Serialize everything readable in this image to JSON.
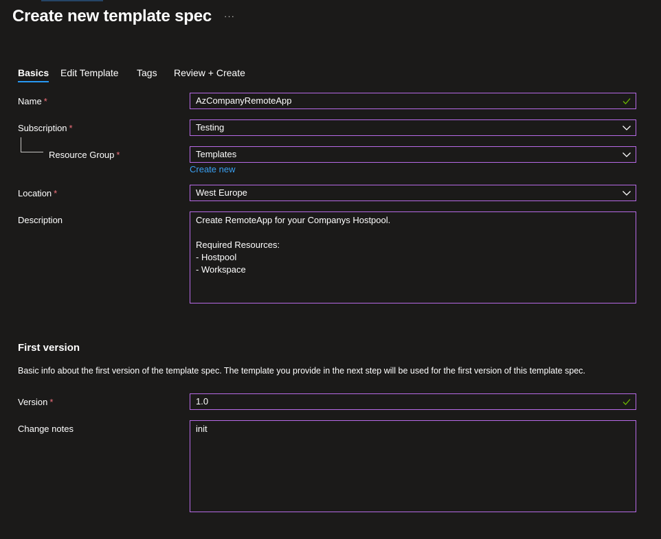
{
  "page": {
    "title": "Create new template spec",
    "more_label": "···"
  },
  "tabs": [
    {
      "label": "Basics",
      "active": true
    },
    {
      "label": "Edit Template",
      "active": false
    },
    {
      "label": "Tags",
      "active": false
    },
    {
      "label": "Review + Create",
      "active": false
    }
  ],
  "form": {
    "name": {
      "label": "Name",
      "required": "*",
      "value": "AzCompanyRemoteApp",
      "valid_icon": "checkmark-icon"
    },
    "subscription": {
      "label": "Subscription",
      "required": "*",
      "value": "Testing",
      "icon": "chevron-down-icon"
    },
    "resource_group": {
      "label": "Resource Group",
      "required": "*",
      "value": "Templates",
      "icon": "chevron-down-icon",
      "create_new": "Create new"
    },
    "location": {
      "label": "Location",
      "required": "*",
      "value": "West Europe",
      "icon": "chevron-down-icon"
    },
    "description": {
      "label": "Description",
      "value": "Create RemoteApp for your Companys Hostpool.\n\nRequired Resources:\n- Hostpool\n- Workspace"
    }
  },
  "first_version": {
    "title": "First version",
    "description": "Basic info about the first version of the template spec. The template you provide in the next step will be used for the first version of this template spec.",
    "version": {
      "label": "Version",
      "required": "*",
      "value": "1.0",
      "valid_icon": "checkmark-icon"
    },
    "change_notes": {
      "label": "Change notes",
      "value": "init"
    }
  },
  "colors": {
    "background": "#1b1a19",
    "field_border": "#b96be9",
    "accent": "#2899f5",
    "link": "#3aa0f3",
    "required": "#f1707b",
    "valid": "#6bb700"
  }
}
